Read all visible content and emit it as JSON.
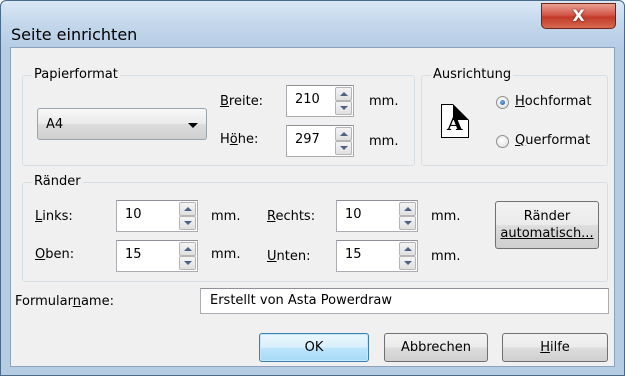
{
  "window": {
    "title": "Seite einrichten",
    "close_glyph": "X"
  },
  "papierformat": {
    "group_label": "Papierformat",
    "format_value": "A4",
    "breite_label_accel": "B",
    "breite_label_rest": "reite:",
    "breite_value": "210",
    "hoehe_label_pre": "H",
    "hoehe_label_accel": "ö",
    "hoehe_label_rest": "he:",
    "hoehe_value": "297",
    "unit": "mm."
  },
  "ausrichtung": {
    "group_label": "Ausrichtung",
    "icon_letter": "A",
    "hochformat_accel": "H",
    "hochformat_rest": "ochformat",
    "hochformat_checked": true,
    "querformat_accel": "Q",
    "querformat_rest": "uerformat",
    "querformat_checked": false
  },
  "raender": {
    "group_label": "Ränder",
    "links_accel": "L",
    "links_rest": "inks:",
    "links_value": "10",
    "rechts_accel": "R",
    "rechts_rest": "echts:",
    "rechts_value": "10",
    "oben_accel": "O",
    "oben_rest": "ben:",
    "oben_value": "15",
    "unten_accel": "U",
    "unten_rest": "nten:",
    "unten_value": "15",
    "unit": "mm.",
    "auto_button_line1": "Ränder",
    "auto_button_line2": "automatisch..."
  },
  "formular": {
    "label_pre": "Formular",
    "label_accel": "n",
    "label_rest": "ame:",
    "value": "Erstellt von Asta Powerdraw"
  },
  "buttons": {
    "ok": "OK",
    "cancel": "Abbrechen",
    "help_accel": "H",
    "help_rest": "ilfe"
  }
}
